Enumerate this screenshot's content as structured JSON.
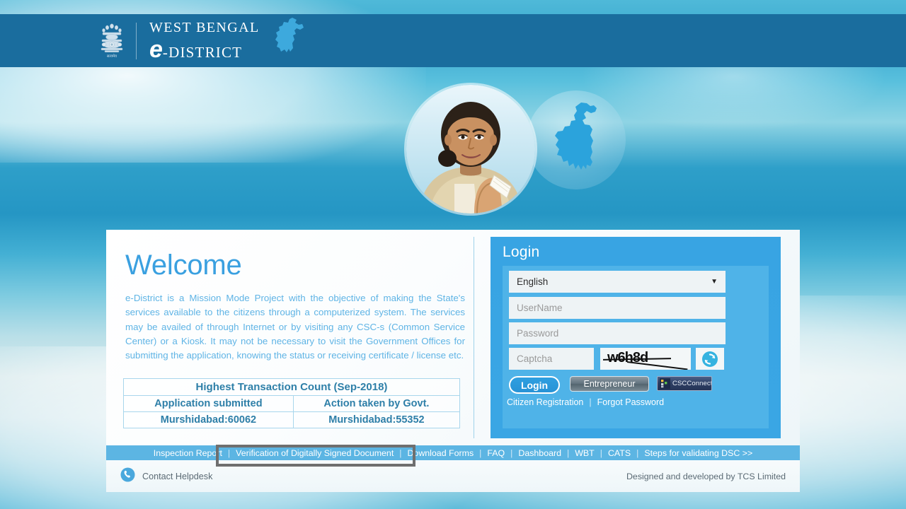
{
  "header": {
    "emblem_icon": "india-state-emblem-icon",
    "emblem_motto": "सत्यमेव जयते",
    "brand_line1": "West Bengal",
    "brand_line2_e": "e",
    "brand_line2_rest": "-District",
    "map_icon": "west-bengal-map-icon",
    "bg_color": "#1a6d9e"
  },
  "hero": {
    "portrait_alt": "chief-minister-portrait",
    "map_alt": "west-bengal-map-graphic"
  },
  "welcome": {
    "title": "Welcome",
    "body": "e-District is a Mission Mode Project with the objective of making the State's services available to the citizens through a computerized system. The services may be availed of through Internet or by visiting any CSC-s (Common Service Center) or a Kiosk. It may not be necessary to visit the Government Offices for submitting the application, knowing the status or receiving certificate / license etc.",
    "title_color": "#3aa0e0",
    "body_color": "#5fb4e5"
  },
  "transaction_table": {
    "header": "Highest Transaction Count (Sep-2018)",
    "columns": [
      "Application submitted",
      "Action taken by Govt."
    ],
    "values": [
      "Murshidabad:60062",
      "Murshidabad:55352"
    ]
  },
  "login": {
    "title": "Login",
    "language_selected": "English",
    "language_caret_icon": "chevron-down-icon",
    "username_placeholder": "UserName",
    "username_value": "",
    "password_placeholder": "Password",
    "password_value": "",
    "captcha_placeholder": "Captcha",
    "captcha_value": "",
    "captcha_text": "w6h8d",
    "refresh_icon": "refresh-captcha-icon",
    "login_button": "Login",
    "entrepreneur_button": "Entrepreneur",
    "csc_button": "CSCConnect",
    "csc_icon": "csc-connect-icon",
    "citizen_registration_link": "Citizen Registration",
    "link_separator": "|",
    "forgot_password_link": "Forgot Password",
    "panel_color": "#38a4e3",
    "inner_color": "#4fb3e8"
  },
  "footer_nav": {
    "items": [
      "Inspection Report",
      "Verification of Digitally Signed Document",
      "Download Forms",
      "FAQ",
      "Dashboard",
      "WBT",
      "CATS",
      "Steps for validating DSC >>"
    ],
    "separator": "|",
    "bg_color": "#5cb5e3",
    "focused_item_index": 1
  },
  "bottom_bar": {
    "helpdesk_icon": "phone-icon",
    "helpdesk_label": "Contact Helpdesk",
    "credit": "Designed and developed by TCS Limited"
  }
}
